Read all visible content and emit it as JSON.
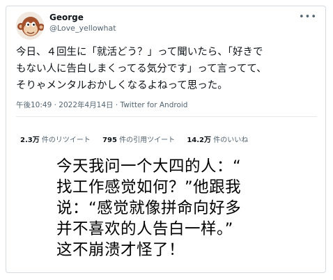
{
  "tweet": {
    "display_name": "George",
    "handle": "@Love_yellowhat",
    "more_icon": "more-horizontal-icon",
    "text_lines": [
      "今日、４回生に「就活どう？」って聞いたら、「好きで",
      "もない人に告白しまくってる気分です」って言ってて、",
      "そりゃメンタルおかしくなるよねって思った。"
    ],
    "meta": "午後10:49 · 2022年4月14日 · Twitter for Android",
    "stats": {
      "retweets_count": "2.3万",
      "retweets_label": "件のリツイート",
      "quotes_count": "795",
      "quotes_label": "件の引用ツイート",
      "likes_count": "14.2万",
      "likes_label": "件のいいね"
    }
  },
  "translation": {
    "lines": [
      "今天我问一个大四的人：“",
      "找工作感觉如何？”他跟我",
      "说：“感觉就像拼命向好多",
      "并不喜欢的人告白一样。”",
      "这不崩溃才怪了！"
    ]
  },
  "colors": {
    "text_primary": "#0f1419",
    "text_secondary": "#536471",
    "border": "#d6dbe0"
  }
}
